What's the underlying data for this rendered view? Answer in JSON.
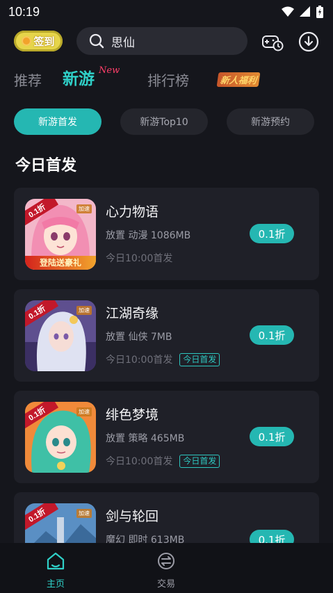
{
  "status_bar": {
    "time": "10:19"
  },
  "header": {
    "checkin_label": "签到",
    "search_value": "思仙",
    "icons": [
      "coin-icon",
      "search-icon",
      "game-history-icon",
      "download-icon"
    ]
  },
  "tabs": {
    "recommend": "推荐",
    "new_games": "新游",
    "new_sup": "New",
    "ranking": "排行榜",
    "new_user_gift": "新人福利"
  },
  "chips": [
    "新游首发",
    "新游Top10",
    "新游预约"
  ],
  "section_title": "今日首发",
  "games": [
    {
      "name": "心力物语",
      "tags": "放置 动漫 1086MB",
      "release": "今日10:00首发",
      "badge": "",
      "discount": "0.1折",
      "thumb_corner": "0.1折",
      "thumb_tag": "加速",
      "thumb_banner": "登陆送豪礼"
    },
    {
      "name": "江湖奇缘",
      "tags": "放置 仙侠 7MB",
      "release": "今日10:00首发",
      "badge": "今日首发",
      "discount": "0.1折",
      "thumb_corner": "0.1折",
      "thumb_tag": "加速",
      "thumb_banner": ""
    },
    {
      "name": "绯色梦境",
      "tags": "放置 策略 465MB",
      "release": "今日10:00首发",
      "badge": "今日首发",
      "discount": "0.1折",
      "thumb_corner": "0.1折",
      "thumb_tag": "加速",
      "thumb_banner": ""
    },
    {
      "name": "剑与轮回",
      "tags": "魔幻 即时 613MB",
      "release": "",
      "badge": "",
      "discount": "0.1折",
      "thumb_corner": "0.1折",
      "thumb_tag": "加速",
      "thumb_banner": ""
    }
  ],
  "bottom_nav": {
    "home": "主页",
    "trade": "交易"
  },
  "colors": {
    "background": "#15161c",
    "card": "#1f2028",
    "accent": "#25b7b2",
    "checkin": "#e6d54a"
  }
}
